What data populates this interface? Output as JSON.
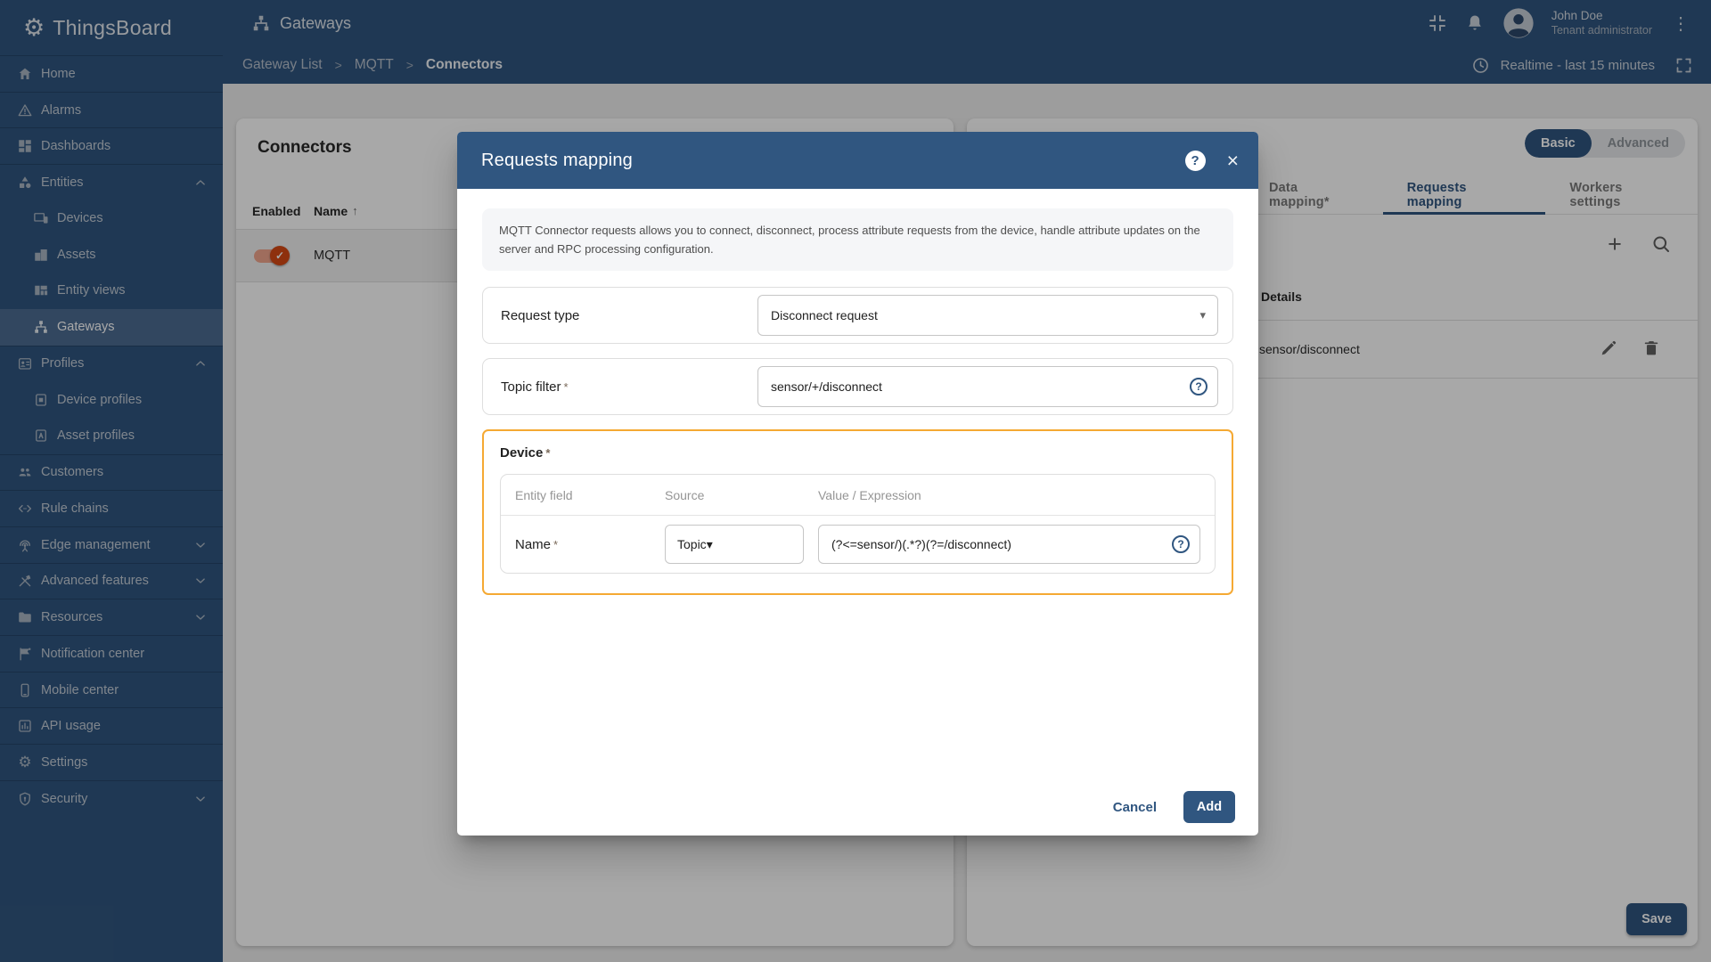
{
  "colors": {
    "primary": "#305680",
    "highlight_border": "#f5a933",
    "toggle_on": "#d84a15"
  },
  "required_marker": "*",
  "app": {
    "name": "ThingsBoard"
  },
  "topbar": {
    "page_title": "Gateways",
    "user": {
      "name": "John Doe",
      "role": "Tenant administrator"
    },
    "timewindow": "Realtime - last 15 minutes"
  },
  "breadcrumb": {
    "separator": ">",
    "items": [
      {
        "label": "Gateway List",
        "current": false
      },
      {
        "label": "MQTT",
        "current": false
      },
      {
        "label": "Connectors",
        "current": true
      }
    ]
  },
  "sidebar": {
    "items": [
      {
        "label": "Home",
        "icon": "home-icon"
      },
      {
        "label": "Alarms",
        "icon": "alarms-icon"
      },
      {
        "label": "Dashboards",
        "icon": "dashboards-icon"
      },
      {
        "label": "Entities",
        "icon": "entities-icon",
        "expanded": true
      },
      {
        "label": "Devices",
        "icon": "devices-icon",
        "sub": true
      },
      {
        "label": "Assets",
        "icon": "assets-icon",
        "sub": true
      },
      {
        "label": "Entity views",
        "icon": "entity-views-icon",
        "sub": true
      },
      {
        "label": "Gateways",
        "icon": "gateways-icon",
        "sub": true,
        "active": true
      },
      {
        "label": "Profiles",
        "icon": "profiles-icon",
        "expanded": true
      },
      {
        "label": "Device profiles",
        "icon": "device-profiles-icon",
        "sub": true
      },
      {
        "label": "Asset profiles",
        "icon": "asset-profiles-icon",
        "sub": true
      },
      {
        "label": "Customers",
        "icon": "customers-icon"
      },
      {
        "label": "Rule chains",
        "icon": "rule-chains-icon"
      },
      {
        "label": "Edge management",
        "icon": "edge-management-icon",
        "collapsed": true
      },
      {
        "label": "Advanced features",
        "icon": "advanced-features-icon",
        "collapsed": true
      },
      {
        "label": "Resources",
        "icon": "resources-icon",
        "collapsed": true
      },
      {
        "label": "Notification center",
        "icon": "notification-center-icon"
      },
      {
        "label": "Mobile center",
        "icon": "mobile-center-icon"
      },
      {
        "label": "API usage",
        "icon": "api-usage-icon"
      },
      {
        "label": "Settings",
        "icon": "settings-icon"
      },
      {
        "label": "Security",
        "icon": "security-icon",
        "collapsed": true
      }
    ]
  },
  "connectors_card": {
    "title": "Connectors",
    "columns": [
      "Enabled",
      "Name"
    ],
    "rows": [
      {
        "name": "MQTT",
        "enabled": true
      }
    ]
  },
  "config_panel": {
    "mode_toggle": {
      "options": [
        "Basic",
        "Advanced"
      ],
      "selected": "Basic"
    },
    "tabs": [
      {
        "label": "Data mapping*",
        "active": false
      },
      {
        "label": "Requests mapping",
        "active": true
      },
      {
        "label": "Workers settings",
        "active": false
      }
    ],
    "details_header": "Details",
    "rows": [
      {
        "details": "sensor/disconnect"
      }
    ],
    "save_label": "Save"
  },
  "modal": {
    "title": "Requests mapping",
    "description": "MQTT Connector requests allows you to connect, disconnect, process attribute requests from the device, handle attribute updates on the server and RPC processing configuration.",
    "request_type": {
      "label": "Request type",
      "value": "Disconnect request"
    },
    "topic_filter": {
      "label": "Topic filter",
      "value": "sensor/+/disconnect"
    },
    "device_section": {
      "label": "Device",
      "columns": [
        "Entity field",
        "Source",
        "Value / Expression"
      ],
      "rows": [
        {
          "field": "Name",
          "source": "Topic",
          "expression": "(?<=sensor/)(.*?)(?=/disconnect)"
        }
      ]
    },
    "cancel_label": "Cancel",
    "add_label": "Add"
  }
}
